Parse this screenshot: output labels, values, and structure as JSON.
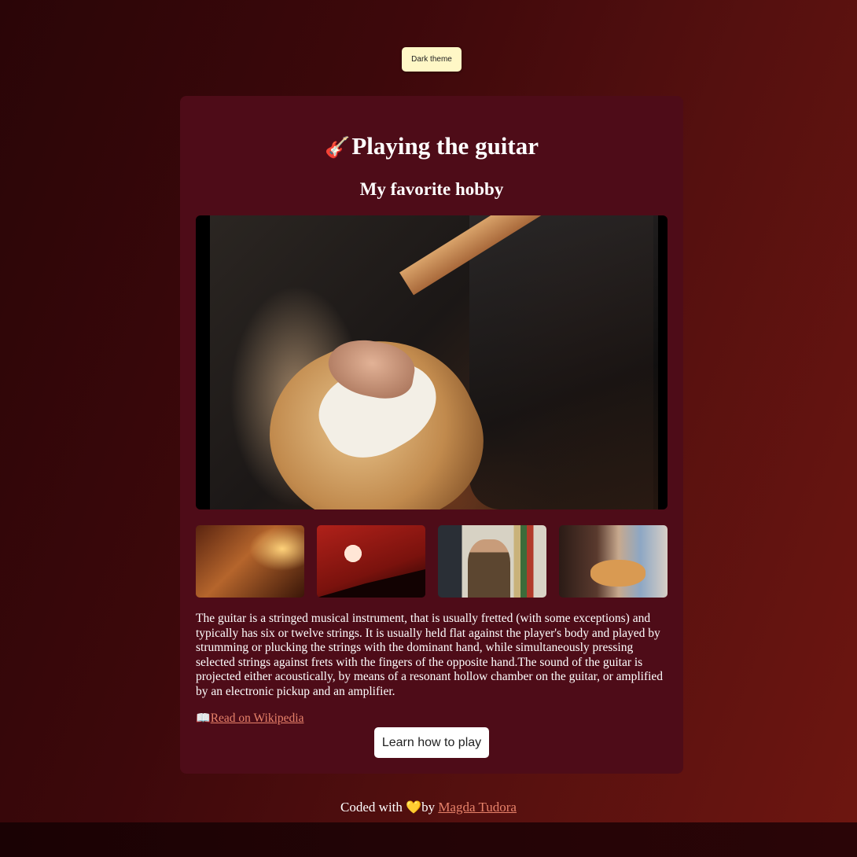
{
  "theme_toggle": {
    "label": "Dark theme"
  },
  "card": {
    "title_icon": "🎸",
    "title": "Playing the guitar",
    "subtitle": "My favorite hobby",
    "hero_image": {
      "icon": "guitarist-photo"
    },
    "thumbnails": [
      {
        "icon": "acoustic-guitar-closeup-photo"
      },
      {
        "icon": "silhouette-guitarist-sunset-photo"
      },
      {
        "icon": "man-playing-electric-guitar-photo"
      },
      {
        "icon": "guitar-lesson-photo"
      }
    ],
    "description": "The guitar is a stringed musical instrument, that is usually fretted (with some exceptions) and typically has six or twelve strings. It is usually held flat against the player's body and played by strumming or plucking the strings with the dominant hand, while simultaneously pressing selected strings against frets with the fingers of the opposite hand.The sound of the guitar is projected either acoustically, by means of a resonant hollow chamber on the guitar, or amplified by an electronic pickup and an amplifier.",
    "wiki_icon": "📖",
    "wiki_link": "Read on Wikipedia",
    "cta_button": "Learn how to play"
  },
  "footer": {
    "prefix": "Coded with ",
    "heart": "💛",
    "middle": "by ",
    "author": "Magda Tudora"
  },
  "colors": {
    "card_bg": "#4e0c18",
    "button_bg": "#fff7c6",
    "link": "#e8826a"
  }
}
